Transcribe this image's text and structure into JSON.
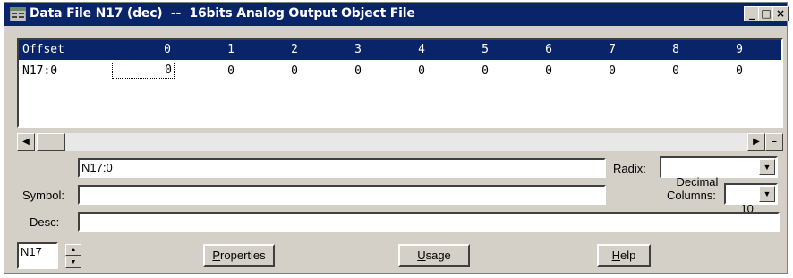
{
  "window": {
    "title": "Data File N17 (dec)  --  16bits Analog Output Object File",
    "controls": {
      "minimize": "_",
      "maximize": "□",
      "close": "×"
    }
  },
  "grid": {
    "header": {
      "offset_label": "Offset",
      "columns": [
        "0",
        "1",
        "2",
        "3",
        "4",
        "5",
        "6",
        "7",
        "8",
        "9"
      ]
    },
    "rows": [
      {
        "address": "N17:0",
        "values": [
          "0",
          "0",
          "0",
          "0",
          "0",
          "0",
          "0",
          "0",
          "0",
          "0"
        ]
      }
    ]
  },
  "form": {
    "address_value": "N17:0",
    "radix_label": "Radix:",
    "radix_value": "Decimal",
    "symbol_label": "Symbol:",
    "symbol_value": "",
    "columns_label": "Columns:",
    "columns_value": "10",
    "desc_label": "Desc:",
    "desc_value": "",
    "file_value": "N17"
  },
  "buttons": {
    "properties": {
      "accel": "P",
      "rest": "roperties"
    },
    "usage": {
      "accel": "U",
      "rest": "sage"
    },
    "help": {
      "accel": "H",
      "rest": "elp"
    }
  },
  "icons": {
    "window": "data-file-icon"
  }
}
